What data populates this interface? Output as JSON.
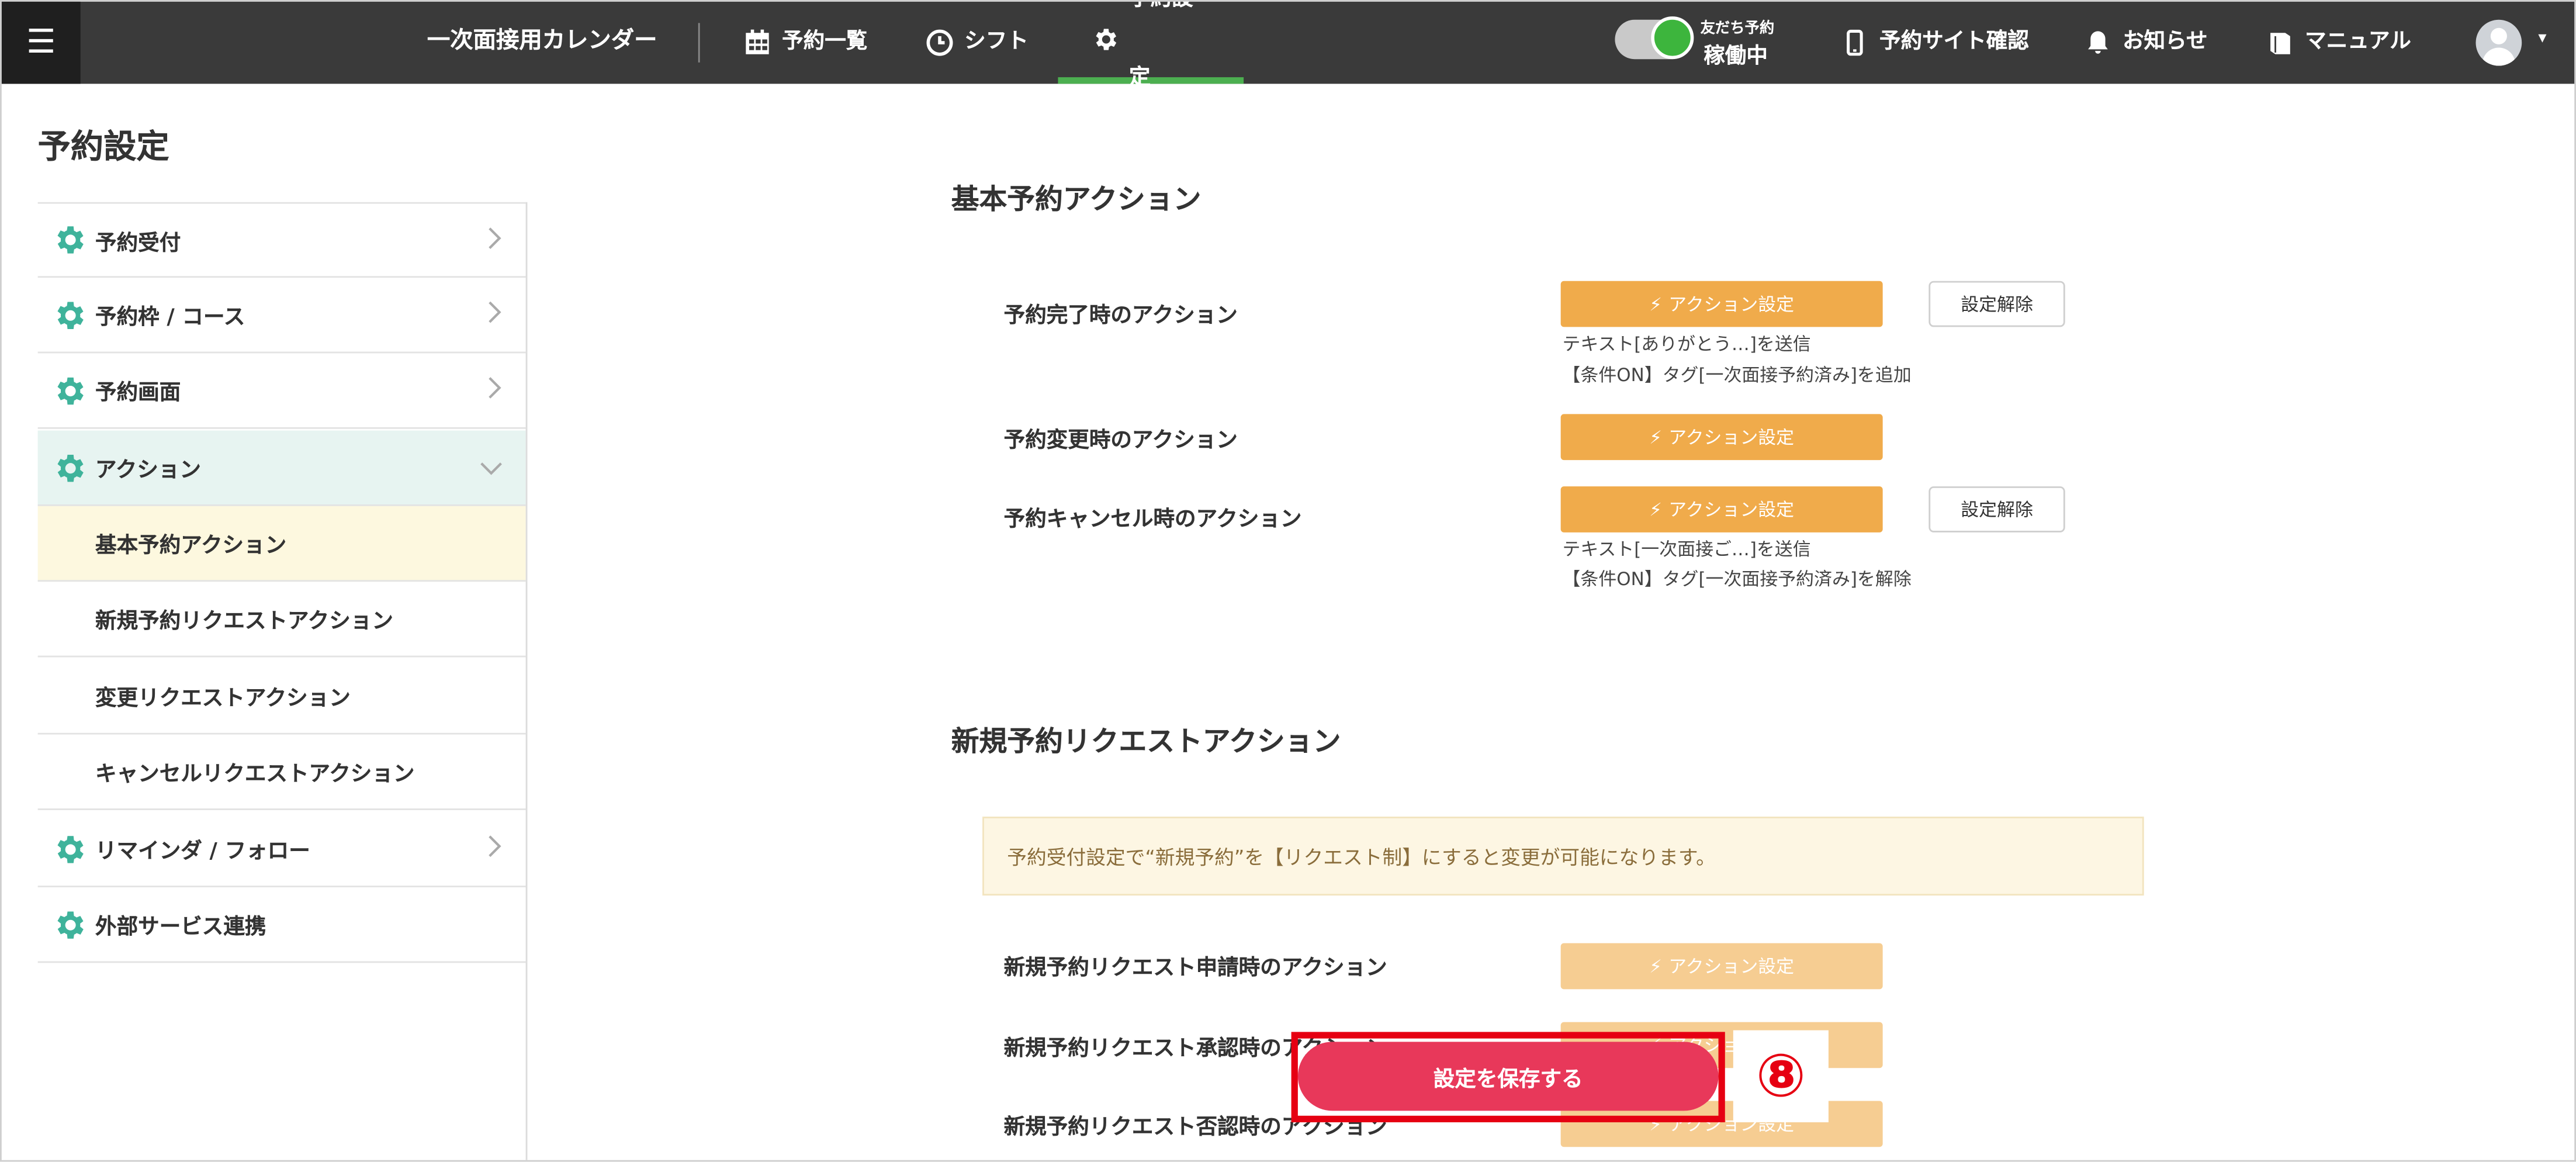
{
  "header": {
    "menu_icon": "☰",
    "app_title": "一次面接用カレンダー",
    "nav": [
      {
        "label": "予約一覧",
        "icon": "calendar-icon"
      },
      {
        "label": "シフト",
        "icon": "clock-icon"
      },
      {
        "label": "予約設定",
        "icon": "gear-icon",
        "active": true
      }
    ],
    "toggle_small": "友だち予約",
    "toggle_big": "稼働中",
    "toggle_on": true,
    "site_check": "予約サイト確認",
    "notice": "お知らせ",
    "manual": "マニュアル",
    "user_caret": "▾"
  },
  "sidebar": {
    "title": "予約設定",
    "items": [
      {
        "label": "予約受付"
      },
      {
        "label": "予約枠 / コース"
      },
      {
        "label": "予約画面"
      },
      {
        "label": "アクション",
        "expanded": true
      },
      {
        "label": "基本予約アクション",
        "selected": true
      },
      {
        "label": "新規予約リクエストアクション"
      },
      {
        "label": "変更リクエストアクション"
      },
      {
        "label": "キャンセルリクエストアクション"
      },
      {
        "label": "リマインダ / フォロー"
      },
      {
        "label": "外部サービス連携"
      }
    ]
  },
  "main": {
    "section1": {
      "heading": "基本予約アクション",
      "rows": [
        {
          "label": "予約完了時のアクション",
          "button": "アクション設定",
          "clear": "設定解除",
          "notes": [
            "テキスト[ありがとう…]を送信",
            "【条件ON】タグ[一次面接予約済み]を追加"
          ]
        },
        {
          "label": "予約変更時のアクション",
          "button": "アクション設定"
        },
        {
          "label": "予約キャンセル時のアクション",
          "button": "アクション設定",
          "clear": "設定解除",
          "notes": [
            "テキスト[一次面接ご…]を送信",
            "【条件ON】タグ[一次面接予約済み]を解除"
          ]
        }
      ]
    },
    "section2": {
      "heading": "新規予約リクエストアクション",
      "info": "予約受付設定で“新規予約”を【リクエスト制】にすると変更が可能になります。",
      "rows": [
        {
          "label": "新規予約リクエスト申請時のアクション",
          "button": "アクション設定"
        },
        {
          "label": "新規予約リクエスト承認時のアクション",
          "button": "アクション設定"
        },
        {
          "label": "新規予約リクエスト否認時のアクション",
          "button": "アクション設定"
        }
      ]
    },
    "save_button": "設定を保存する",
    "callout_number": "⑧"
  },
  "colors": {
    "topbar": "#3a3a3a",
    "accent_green": "#4caf50",
    "action_orange": "#f0ab4b",
    "save_red": "#e8385a",
    "callout_red": "#e60012",
    "gear_teal": "#3fb39b"
  }
}
